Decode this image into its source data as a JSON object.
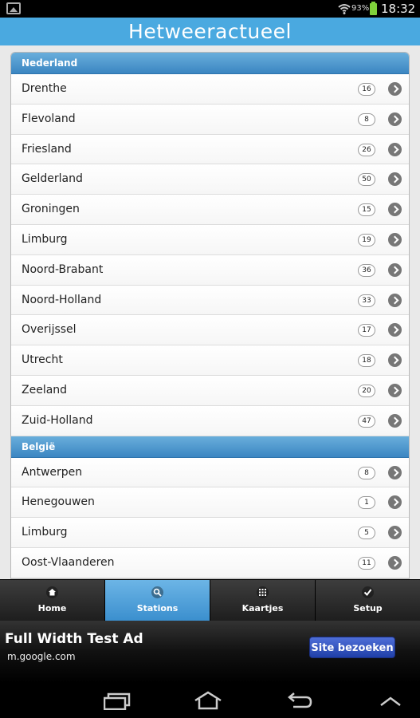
{
  "status_bar": {
    "battery_percent": "93%",
    "time": "18:32"
  },
  "title": "Hetweeractueel",
  "groups": [
    {
      "name": "Nederland",
      "items": [
        {
          "label": "Drenthe",
          "count": "16"
        },
        {
          "label": "Flevoland",
          "count": "8"
        },
        {
          "label": "Friesland",
          "count": "26"
        },
        {
          "label": "Gelderland",
          "count": "50"
        },
        {
          "label": "Groningen",
          "count": "15"
        },
        {
          "label": "Limburg",
          "count": "19"
        },
        {
          "label": "Noord-Brabant",
          "count": "36"
        },
        {
          "label": "Noord-Holland",
          "count": "33"
        },
        {
          "label": "Overijssel",
          "count": "17"
        },
        {
          "label": "Utrecht",
          "count": "18"
        },
        {
          "label": "Zeeland",
          "count": "20"
        },
        {
          "label": "Zuid-Holland",
          "count": "47"
        }
      ]
    },
    {
      "name": "België",
      "items": [
        {
          "label": "Antwerpen",
          "count": "8"
        },
        {
          "label": "Henegouwen",
          "count": "1"
        },
        {
          "label": "Limburg",
          "count": "5"
        },
        {
          "label": "Oost-Vlaanderen",
          "count": "11"
        }
      ]
    }
  ],
  "nav": {
    "home": "Home",
    "stations": "Stations",
    "kaartjes": "Kaartjes",
    "setup": "Setup",
    "active": "stations"
  },
  "ad": {
    "title": "Full Width Test Ad",
    "url": "m.google.com",
    "button": "Site bezoeken"
  },
  "colors": {
    "accent": "#4aa9e0",
    "divider": "#3b86c2",
    "ad_button": "#2a4bb8"
  }
}
